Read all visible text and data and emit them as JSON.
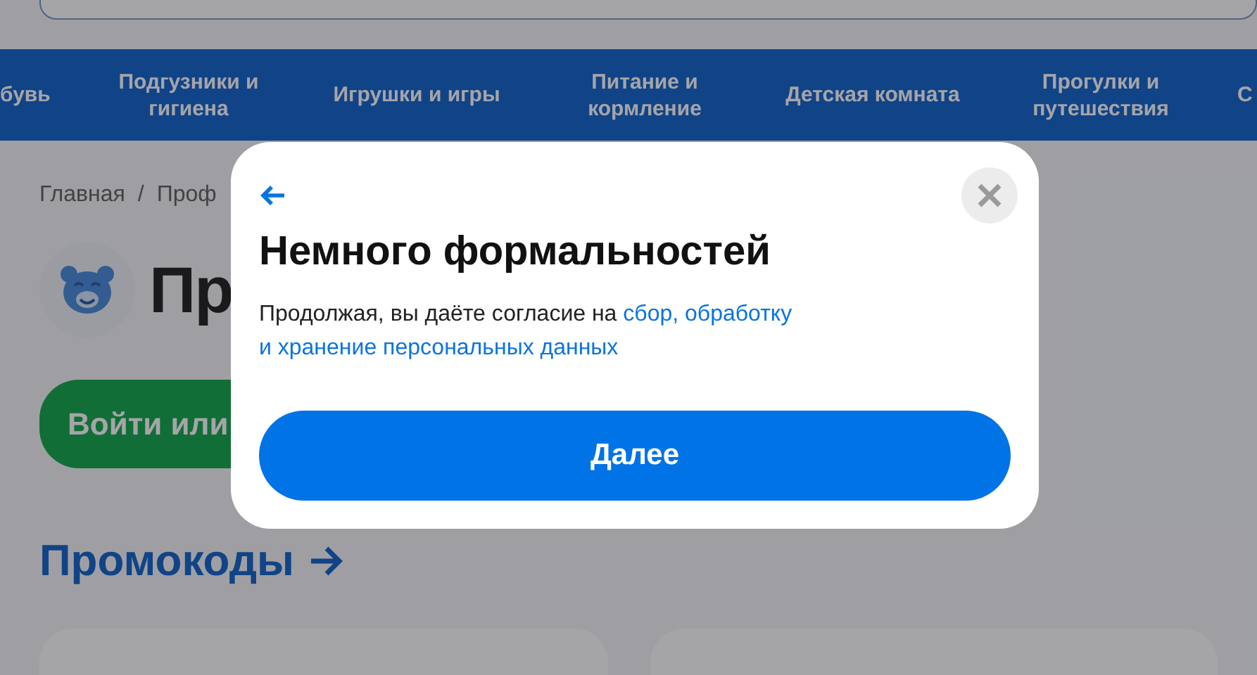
{
  "nav": {
    "items": [
      "бувь",
      "Подгузники и гигиена",
      "Игрушки и игры",
      "Питание и кормление",
      "Детская комната",
      "Прогулки и путешествия",
      "С"
    ]
  },
  "breadcrumbs": [
    "Главная",
    "/",
    "Проф"
  ],
  "profile": {
    "title": "Пр",
    "login_button": "Войти или"
  },
  "promo": {
    "heading": "Промокоды",
    "cards": [
      {
        "kind": "card"
      },
      {
        "kind": "card"
      }
    ]
  },
  "dialog": {
    "title": "Немного формальностей",
    "text": "Продолжая, вы даёте согласие на ",
    "link_lines": [
      "сбор, обработку",
      "и хранение персональных данных"
    ],
    "button": "Далее"
  }
}
